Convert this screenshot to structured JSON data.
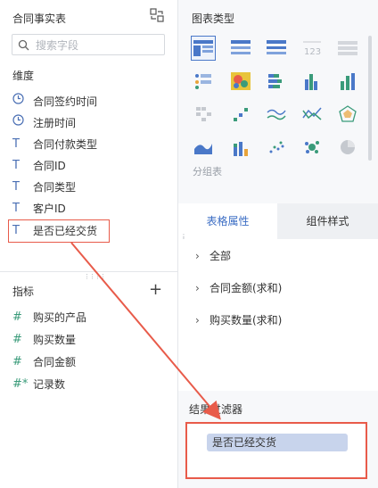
{
  "left_panel": {
    "title": "合同事实表",
    "search_placeholder": "搜索字段",
    "dimensions_label": "维度",
    "dimensions": [
      {
        "icon": "clock-icon",
        "label": "合同签约时间"
      },
      {
        "icon": "clock-icon",
        "label": "注册时间"
      },
      {
        "icon": "text-type-icon",
        "label": "合同付款类型"
      },
      {
        "icon": "text-type-icon",
        "label": "合同ID"
      },
      {
        "icon": "text-type-icon",
        "label": "合同类型"
      },
      {
        "icon": "text-type-icon",
        "label": "客户ID"
      },
      {
        "icon": "text-type-icon",
        "label": "是否已经交货"
      }
    ],
    "metrics_label": "指标",
    "metrics": [
      {
        "icon": "hash-icon",
        "label": "购买的产品"
      },
      {
        "icon": "hash-icon",
        "label": "购买数量"
      },
      {
        "icon": "hash-icon",
        "label": "合同金额"
      },
      {
        "icon": "hash-star-icon",
        "label": "记录数"
      }
    ]
  },
  "right_panel": {
    "chart_types_label": "图表类型",
    "group_table_label": "分组表",
    "chart_icons": [
      "group-table",
      "detail-table",
      "cross-table",
      "kpi-card",
      "kpi-list",
      "pattern-chart",
      "heatmap",
      "stacked-bar",
      "bar",
      "column",
      "dot-chart",
      "step-chart",
      "line",
      "multi-line",
      "radar",
      "area",
      "stacked-column",
      "scatter",
      "bubble",
      "pie"
    ],
    "tabs": {
      "active": "表格属性",
      "inactive": "组件样式"
    },
    "properties": [
      "全部",
      "合同金额(求和)",
      "购买数量(求和)"
    ],
    "filter_label": "结果过滤器",
    "filter_chip": "是否已经交货"
  },
  "colors": {
    "accent": "#3b6dc4",
    "highlight": "#e85b4a",
    "chip": "#c8d4ec"
  }
}
